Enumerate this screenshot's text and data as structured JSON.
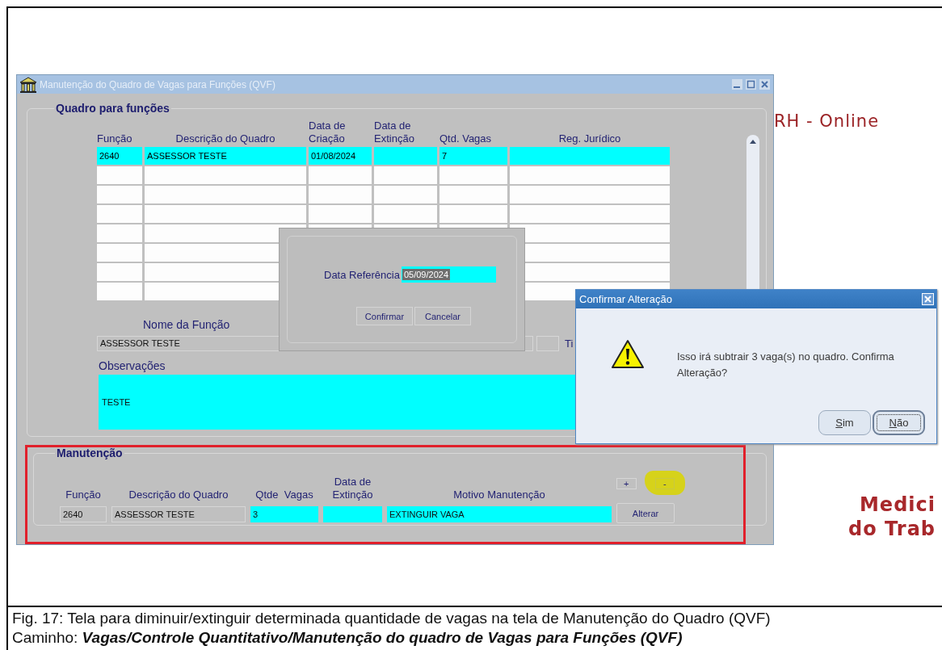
{
  "document": {
    "caption": "Fig. 17: Tela para diminuir/extinguir determinada quantidade de vagas na tela de Manutenção do Quadro (QVF)",
    "path_label": "Caminho:",
    "path": "Vagas/Controle Quantitativo/Manutenção do quadro de Vagas para Funções (QVF)"
  },
  "background": {
    "brand": "RH - Online",
    "footer_lines": [
      "Medici",
      "do Trab"
    ]
  },
  "main_window": {
    "title": "Manutenção do Quadro de Vagas para Funções (QVF)",
    "active": false
  },
  "quadro": {
    "title": "Quadro para funções",
    "columns": [
      [
        "Função"
      ],
      [
        "Descrição do Quadro"
      ],
      [
        "Data de",
        "Criação"
      ],
      [
        "Data de",
        "Extinção"
      ],
      [
        "Qtd. Vagas"
      ],
      [
        "Reg. Jurídico"
      ]
    ],
    "rows": [
      {
        "current": true,
        "cells": [
          "2640",
          "ASSESSOR TESTE",
          "01/08/2024",
          null,
          "7",
          null
        ]
      },
      {
        "current": false
      },
      {
        "current": false
      },
      {
        "current": false
      },
      {
        "current": false
      },
      {
        "current": false
      },
      {
        "current": false
      },
      {
        "current": false
      }
    ],
    "name_label": "Nome da Função",
    "name_value": "ASSESSOR TESTE",
    "type_label": "Ti",
    "notes_label": "Observações",
    "notes_value": "TESTE"
  },
  "manutencao": {
    "title": "Manutenção",
    "highlighted": true,
    "fields": [
      {
        "label": [
          "Função"
        ],
        "value": "2640",
        "editable": false
      },
      {
        "label": [
          "Descrição do Quadro"
        ],
        "value": "ASSESSOR TESTE",
        "editable": false
      },
      {
        "label": [
          "Qtde  Vagas"
        ],
        "value": "3",
        "editable": true
      },
      {
        "label": [
          "Data de",
          "Extinção"
        ],
        "editable": true
      },
      {
        "label": [
          "Motivo Manutenção"
        ],
        "value": "EXTINGUIR VAGA",
        "editable": true
      }
    ],
    "add_button": "+",
    "remove_button": {
      "label": "-",
      "marked": true
    },
    "alter_button": "Alterar"
  },
  "date_dialog": {
    "label": "Data Referência",
    "value": "05/09/2024",
    "value_selected": true,
    "buttons": [
      "Confirmar",
      "Cancelar"
    ]
  },
  "confirm_dialog": {
    "title": "Confirmar Alteração",
    "message": "Isso irá subtrair 3 vaga(s) no quadro. Confirma Alteração?",
    "buttons": [
      {
        "label": "Sim",
        "focused": false
      },
      {
        "label": "Não",
        "focused": true
      }
    ]
  }
}
